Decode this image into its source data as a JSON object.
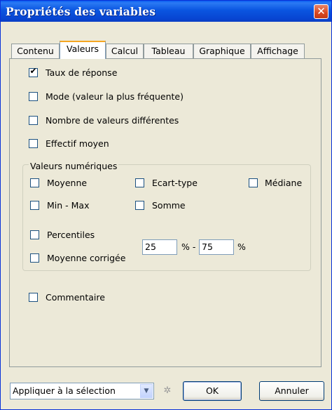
{
  "window": {
    "title": "Propriétés des variables",
    "close_glyph": "✕"
  },
  "tabs": [
    {
      "label": "Contenu",
      "active": false
    },
    {
      "label": "Valeurs",
      "active": true
    },
    {
      "label": "Calcul",
      "active": false
    },
    {
      "label": "Tableau",
      "active": false
    },
    {
      "label": "Graphique",
      "active": false
    },
    {
      "label": "Affichage",
      "active": false
    }
  ],
  "options": {
    "taux_reponse": {
      "label": "Taux de réponse",
      "checked": true
    },
    "mode": {
      "label": "Mode (valeur la plus fréquente)",
      "checked": false
    },
    "nb_valeurs": {
      "label": "Nombre de valeurs différentes",
      "checked": false
    },
    "effectif_moyen": {
      "label": "Effectif moyen",
      "checked": false
    }
  },
  "numeric": {
    "group_label": "Valeurs numériques",
    "moyenne": {
      "label": "Moyenne",
      "checked": false
    },
    "ecart_type": {
      "label": "Ecart-type",
      "checked": false
    },
    "mediane": {
      "label": "Médiane",
      "checked": false
    },
    "min_max": {
      "label": "Min - Max",
      "checked": false
    },
    "somme": {
      "label": "Somme",
      "checked": false
    },
    "percentiles": {
      "label": "Percentiles",
      "checked": false
    },
    "moyenne_corrigee": {
      "label": "Moyenne corrigée",
      "checked": false
    },
    "percentile_low": "25",
    "percentile_sep": "% -",
    "percentile_high": "75",
    "percent_suffix": "%"
  },
  "commentaire": {
    "label": "Commentaire",
    "checked": false
  },
  "footer": {
    "apply_select": "Appliquer à la sélection",
    "ok": "OK",
    "cancel": "Annuler"
  },
  "checkmark": "✔",
  "icons": {
    "close": "close-icon",
    "dropdown": "chevron-down-icon",
    "refresh": "refresh-icon"
  }
}
